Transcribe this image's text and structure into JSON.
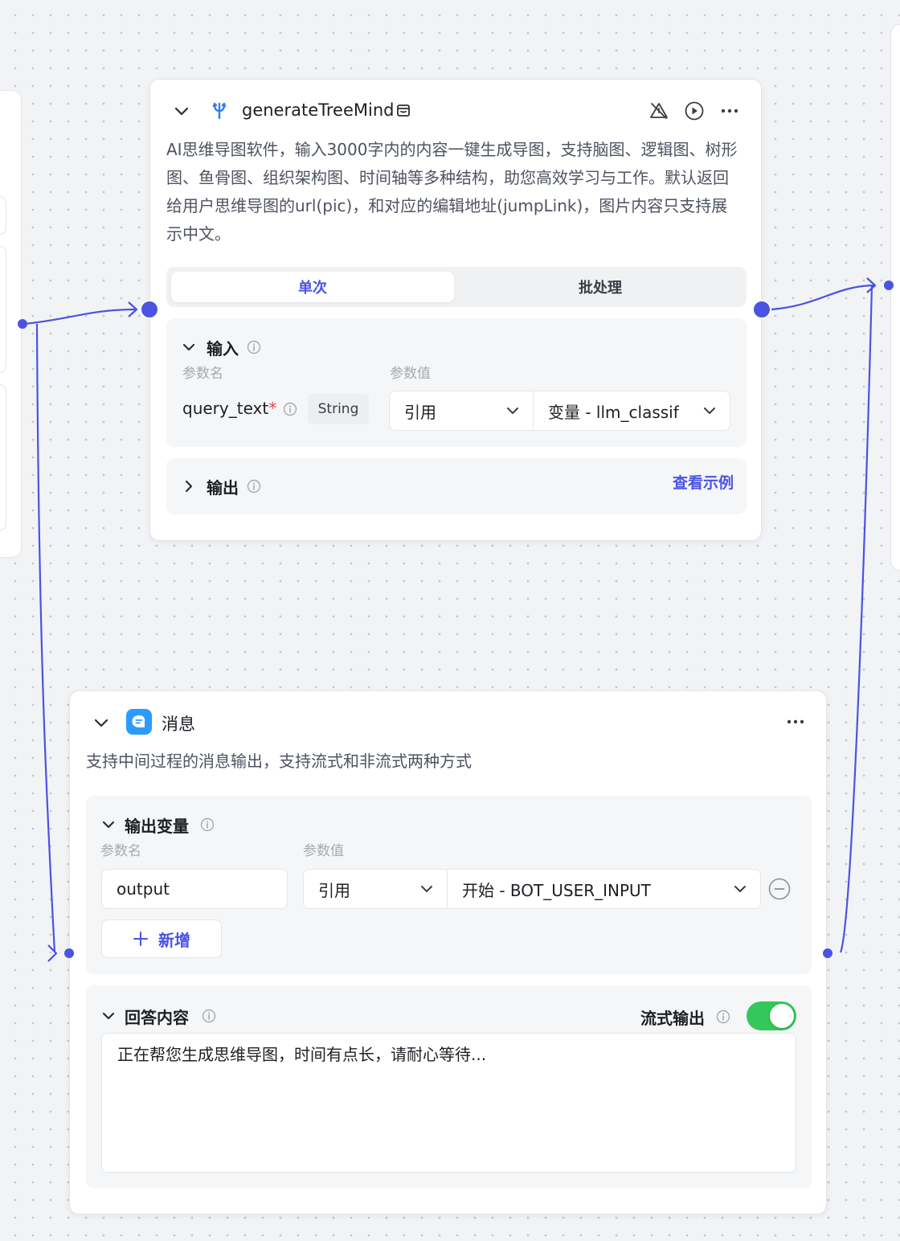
{
  "tool_node": {
    "title": "generateTreeMind",
    "description": "AI思维导图软件，输入3000字内的内容一键生成导图，支持脑图、逻辑图、树形图、鱼骨图、组织架构图、时间轴等多种结构，助您高效学习与工作。默认返回给用户思维导图的url(pic)，和对应的编辑地址(jumpLink)，图片内容只支持展示中文。",
    "tabs": [
      {
        "label": "单次",
        "active": true
      },
      {
        "label": "批处理",
        "active": false
      }
    ],
    "input": {
      "title": "输入",
      "col_name": "参数名",
      "col_value": "参数值",
      "param_name": "query_text",
      "required_mark": "*",
      "param_type": "String",
      "ref_mode": "引用",
      "ref_value": "变量 - llm_classif"
    },
    "output": {
      "title": "输出",
      "example_link": "查看示例"
    }
  },
  "message_node": {
    "title": "消息",
    "description": "支持中间过程的消息输出，支持流式和非流式两种方式",
    "output_vars": {
      "title": "输出变量",
      "col_name": "参数名",
      "col_value": "参数值",
      "var_name": "output",
      "ref_mode": "引用",
      "ref_value": "开始 - BOT_USER_INPUT",
      "add_label": "新增"
    },
    "answer": {
      "title": "回答内容",
      "stream_label": "流式输出",
      "stream_enabled": true,
      "content": "正在帮您生成思维导图，时间有点长，请耐心等待..."
    }
  },
  "colors": {
    "accent": "#4b53e2",
    "toggle_on": "#34c759",
    "required": "#e5484d",
    "message_icon": "#2c9bff"
  }
}
